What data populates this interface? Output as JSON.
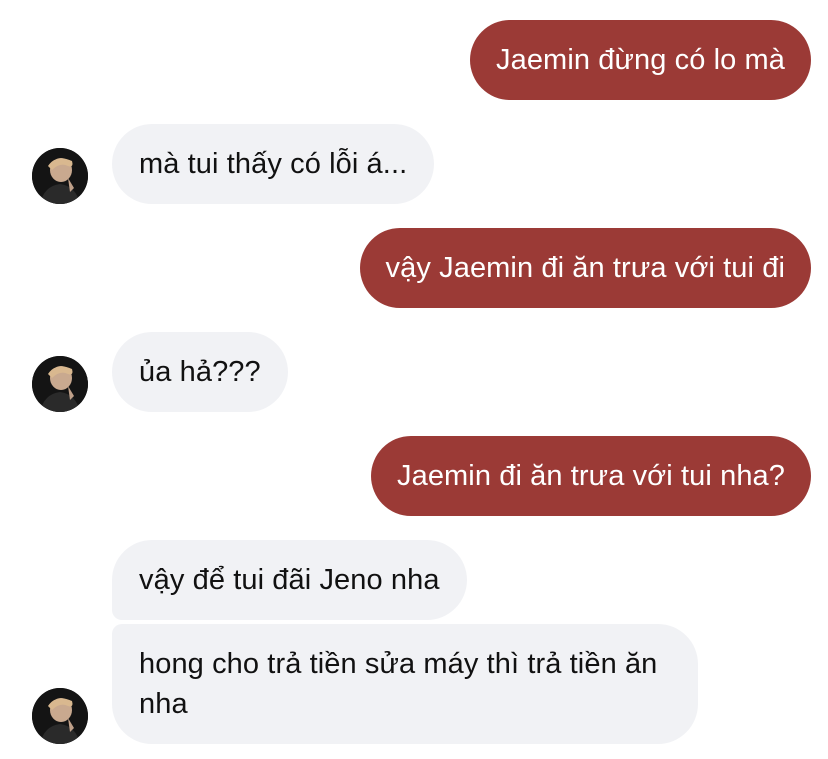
{
  "conversation": {
    "messages": [
      {
        "sender": "me",
        "text": "Jaemin đừng có lo mà"
      },
      {
        "sender": "contact",
        "text": "mà tui thấy có lỗi á..."
      },
      {
        "sender": "me",
        "text": "vậy Jaemin đi ăn trưa với tui đi"
      },
      {
        "sender": "contact",
        "text": "ủa hả???"
      },
      {
        "sender": "me",
        "text": "Jaemin đi ăn trưa với tui nha?"
      },
      {
        "sender": "contact",
        "text": "vậy để tui đãi Jeno nha"
      },
      {
        "sender": "contact",
        "text": "hong cho trả tiền sửa máy thì trả tiền ăn nha"
      }
    ]
  },
  "colors": {
    "outgoing_bubble": "#9b3a36",
    "incoming_bubble": "#f1f2f5",
    "outgoing_text": "#ffffff",
    "incoming_text": "#111111"
  },
  "icons": {
    "contact_avatar": "avatar-photo-icon"
  }
}
